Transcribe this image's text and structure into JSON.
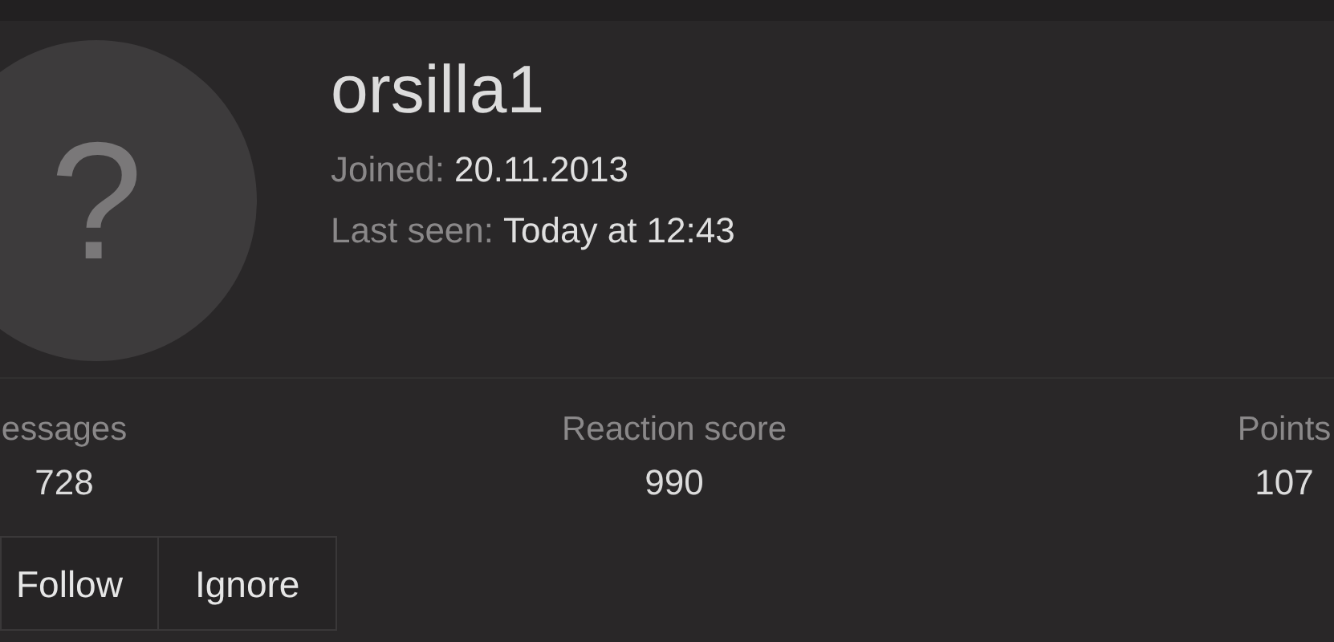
{
  "avatar": {
    "text": "?"
  },
  "user": {
    "name": "orsilla1",
    "joined_label": "Joined:",
    "joined": "20.11.2013",
    "last_seen_label": "Last seen:",
    "last_seen": "Today at 12:43"
  },
  "stats": [
    {
      "label": "essages",
      "value": "728"
    },
    {
      "label": "Reaction score",
      "value": "990"
    },
    {
      "label": "Points",
      "value": "107"
    }
  ],
  "buttons": [
    "Follow",
    "Ignore"
  ]
}
